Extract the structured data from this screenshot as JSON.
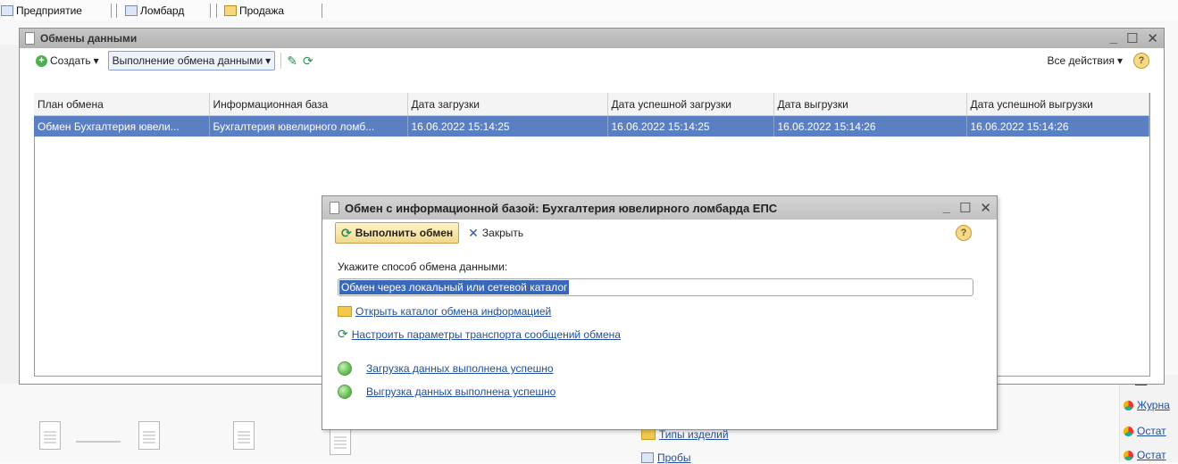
{
  "sections": [
    {
      "label": "Предприятие",
      "icon": "enterprise-icon"
    },
    {
      "label": "Ломбард",
      "icon": "pawnshop-icon"
    },
    {
      "label": "Продажа",
      "icon": "sales-icon"
    }
  ],
  "background": {
    "right_links": [
      "на",
      "Журна",
      "Остат",
      "Остат"
    ],
    "center_links": [
      "Типы изделий",
      "Пробы"
    ],
    "left_fragments": [
      "",
      "",
      ""
    ]
  },
  "main_window": {
    "title": "Обмены данными",
    "toolbar": {
      "create_label": "Создать",
      "exec_label": "Выполнение обмена данными",
      "all_actions_label": "Все действия"
    },
    "columns": [
      "План обмена",
      "Информационная база",
      "Дата загрузки",
      "Дата успешной загрузки",
      "Дата выгрузки",
      "Дата успешной выгрузки"
    ],
    "rows": [
      [
        "Обмен Бухгалтерия ювели...",
        "Бухгалтерия ювелирного ломб...",
        "16.06.2022 15:14:25",
        "16.06.2022 15:14:25",
        "16.06.2022 15:14:26",
        "16.06.2022 15:14:26"
      ]
    ],
    "selected_row_color": "#5a7fc2"
  },
  "dialog": {
    "title": "Обмен с информационной базой: Бухгалтерия ювелирного ломбарда ЕПС",
    "run_label": "Выполнить обмен",
    "close_label": "Закрыть",
    "method_label": "Укажите способ обмена данными:",
    "method_value": "Обмен через локальный или сетевой каталог",
    "open_catalog_link": "Открыть каталог обмена информацией",
    "transport_link": "Настроить параметры транспорта сообщений обмена",
    "load_status": "Загрузка данных выполнена успешно",
    "unload_status": "Выгрузка данных выполнена успешно"
  }
}
